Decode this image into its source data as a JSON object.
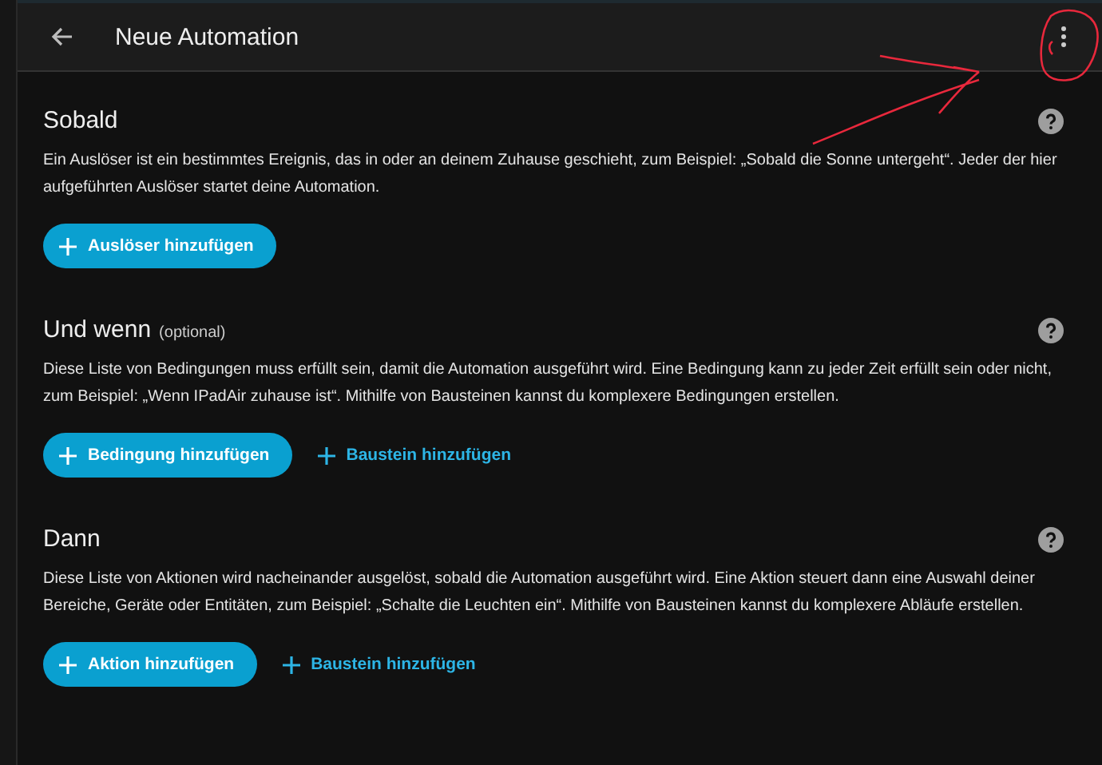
{
  "header": {
    "title": "Neue Automation"
  },
  "sections": [
    {
      "title": "Sobald",
      "description": "Ein Auslöser ist ein bestimmtes Ereignis, das in oder an deinem Zuhause geschieht, zum Beispiel: „Sobald die Sonne untergeht“. Jeder der hier aufgeführten Auslöser startet deine Automation.",
      "buttons": [
        {
          "kind": "primary",
          "label": "Auslöser hinzufügen"
        }
      ]
    },
    {
      "title": "Und wenn",
      "note": "(optional)",
      "description": "Diese Liste von Bedingungen muss erfüllt sein, damit die Automation ausgeführt wird. Eine Bedingung kann zu jeder Zeit erfüllt sein oder nicht, zum Beispiel: „Wenn IPadAir zuhause ist“. Mithilfe von Bausteinen kannst du komplexere Bedingungen erstellen.",
      "buttons": [
        {
          "kind": "primary",
          "label": "Bedingung hinzufügen"
        },
        {
          "kind": "text",
          "label": "Baustein hinzufügen"
        }
      ]
    },
    {
      "title": "Dann",
      "description": "Diese Liste von Aktionen wird nacheinander ausgelöst, sobald die Automation ausgeführt wird. Eine Aktion steuert dann eine Auswahl deiner Bereiche, Geräte oder Entitäten, zum Beispiel: „Schalte die Leuchten ein“. Mithilfe von Bausteinen kannst du komplexere Abläufe erstellen.",
      "buttons": [
        {
          "kind": "primary",
          "label": "Aktion hinzufügen"
        },
        {
          "kind": "text",
          "label": "Baustein hinzufügen"
        }
      ]
    }
  ]
}
